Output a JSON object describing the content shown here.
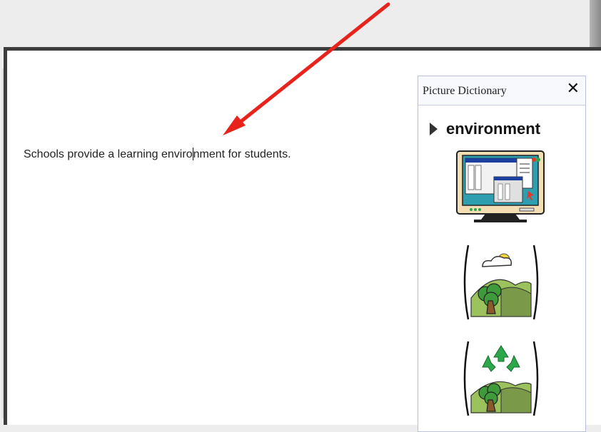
{
  "document": {
    "text_before_caret": "Schools provide a learning enviro",
    "text_after_caret": "nment for students."
  },
  "picture_dictionary": {
    "title": "Picture Dictionary",
    "close_icon": "close-icon",
    "word": "environment",
    "expand_icon": "triangle-right-icon",
    "symbols": [
      "computer-monitor-icon",
      "landscape-sun-tree-icon",
      "recycle-tree-icon"
    ]
  },
  "annotation": {
    "arrow_color": "#e8231c"
  },
  "colors": {
    "panel_border": "#b8bfe0",
    "window_border": "#3d3d3d"
  }
}
